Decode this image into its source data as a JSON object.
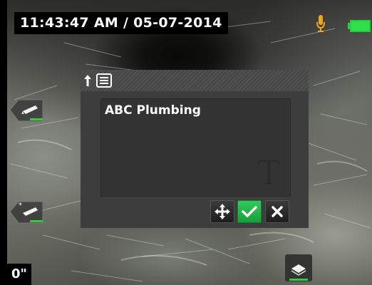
{
  "status_bar": {
    "timestamp": "11:43:47 AM / 05-07-2014",
    "icons": [
      "microphone-icon",
      "battery-icon"
    ],
    "battery_color": "#1fcf3b",
    "mic_color": "#f2a515"
  },
  "side_controls": {
    "left_top_icon": "flashlight-icon",
    "left_bottom_icon": "flashlight-adjust-icon",
    "bottom_right_icon": "tray-icon",
    "indicator_color": "#2fcf3e"
  },
  "zoom": {
    "value": "0\""
  },
  "text_dialog": {
    "header_icons": [
      "up-arrow-icon",
      "list-icon"
    ],
    "text_value": "ABC Plumbing",
    "text_mode_icon_glyph": "T",
    "buttons": {
      "move_icon": "move-arrows-icon",
      "confirm_icon": "checkmark-icon",
      "cancel_icon": "close-icon"
    },
    "confirm_color": "#22b64a"
  }
}
